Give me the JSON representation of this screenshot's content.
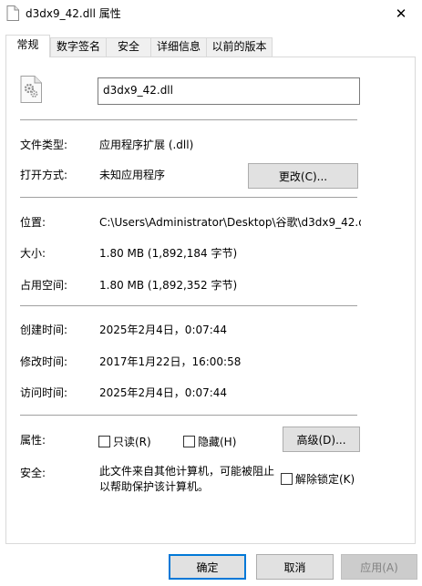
{
  "window": {
    "title": "d3dx9_42.dll 属性",
    "close_icon": "close-icon"
  },
  "tabs": [
    {
      "label": "常规",
      "active": true
    },
    {
      "label": "数字签名",
      "active": false
    },
    {
      "label": "安全",
      "active": false
    },
    {
      "label": "详细信息",
      "active": false
    },
    {
      "label": "以前的版本",
      "active": false
    }
  ],
  "general": {
    "file_icon": "dll-file-icon",
    "file_name": "d3dx9_42.dll",
    "type_label": "文件类型:",
    "type_value": "应用程序扩展 (.dll)",
    "opens_with_label": "打开方式:",
    "opens_with_value": "未知应用程序",
    "change_button": "更改(C)...",
    "location_label": "位置:",
    "location_value": "C:\\Users\\Administrator\\Desktop\\谷歌\\d3dx9_42.d",
    "size_label": "大小:",
    "size_value": "1.80 MB (1,892,184 字节)",
    "size_on_disk_label": "占用空间:",
    "size_on_disk_value": "1.80 MB (1,892,352 字节)",
    "created_label": "创建时间:",
    "created_value": "2025年2月4日，0:07:44",
    "modified_label": "修改时间:",
    "modified_value": "2017年1月22日，16:00:58",
    "accessed_label": "访问时间:",
    "accessed_value": "2025年2月4日，0:07:44",
    "attributes_label": "属性:",
    "readonly_label": "只读(R)",
    "hidden_label": "隐藏(H)",
    "advanced_button": "高级(D)...",
    "security_label": "安全:",
    "security_text": "此文件来自其他计算机，可能被阻止以帮助保护该计算机。",
    "unblock_label": "解除锁定(K)"
  },
  "footer": {
    "ok": "确定",
    "cancel": "取消",
    "apply": "应用(A)"
  }
}
